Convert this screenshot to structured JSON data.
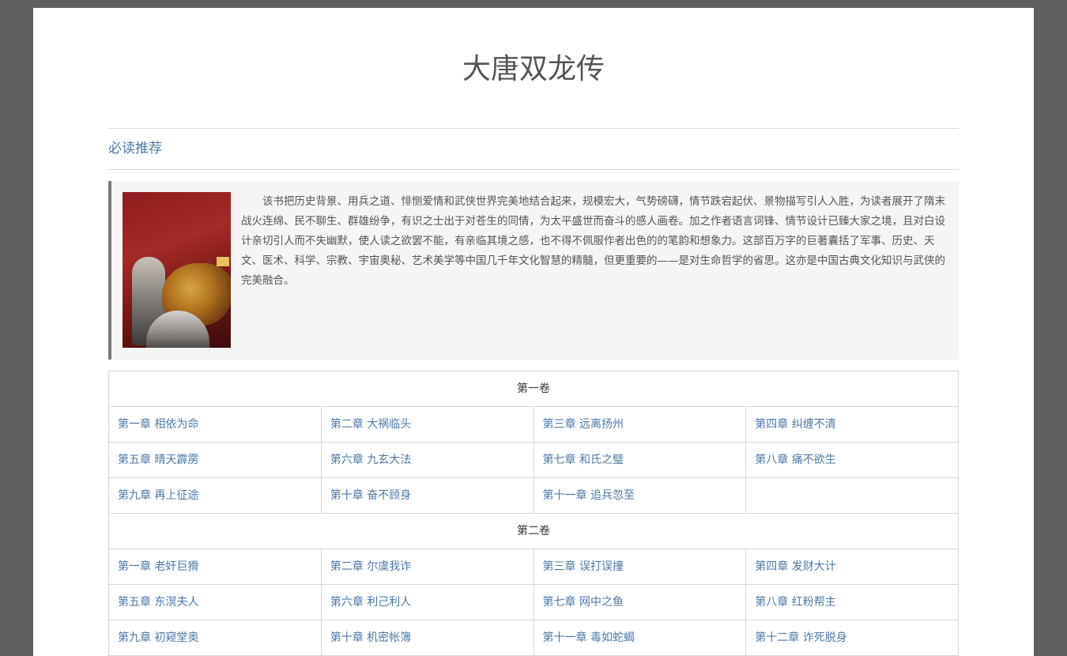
{
  "book": {
    "title": "大唐双龙传"
  },
  "section": {
    "title": "必读推荐"
  },
  "intro": {
    "cover_alt": "大唐双龙传",
    "text": "该书把历史背景、用兵之道、悱恻爱情和武侠世界完美地结合起来，规模宏大，气势磅礴，情节跌宕起伏、景物描写引人入胜，为读者展开了隋末战火连绵、民不聊生、群雄纷争，有识之士出于对苍生的同情，为太平盛世而奋斗的感人画卷。加之作者语言词锋、情节设计已臻大家之境，且对白设计亲切引人而不失幽默，使人读之欲罢不能，有亲临其境之感，也不得不佩服作者出色的的笔韵和想象力。这部百万字的巨著囊括了军事、历史、天文、医术、科学、宗教、宇宙奥秘、艺术美学等中国几千年文化智慧的精髓，但更重要的——是对生命哲学的省思。这亦是中国古典文化知识与武侠的完美融合。"
  },
  "volumes": [
    {
      "title": "第一卷",
      "rows": [
        [
          "第一章 相依为命",
          "第二章 大祸临头",
          "第三章 远离扬州",
          "第四章 纠缠不清"
        ],
        [
          "第五章 晴天霹雳",
          "第六章 九玄大法",
          "第七章 和氏之璧",
          "第八章 痛不欲生"
        ],
        [
          "第九章 再上征途",
          "第十章 奋不顾身",
          "第十一章 追兵忽至",
          ""
        ]
      ]
    },
    {
      "title": "第二卷",
      "rows": [
        [
          "第一章 老奸巨猾",
          "第二章 尔虞我诈",
          "第三章 误打误撞",
          "第四章 发财大计"
        ],
        [
          "第五章 东溟夫人",
          "第六章 利己利人",
          "第七章 网中之鱼",
          "第八章 红粉帮主"
        ],
        [
          "第九章 初窥堂奥",
          "第十章 机密帐簿",
          "第十一章 毒如蛇蝎",
          "第十二章 诈死脱身"
        ]
      ]
    }
  ]
}
